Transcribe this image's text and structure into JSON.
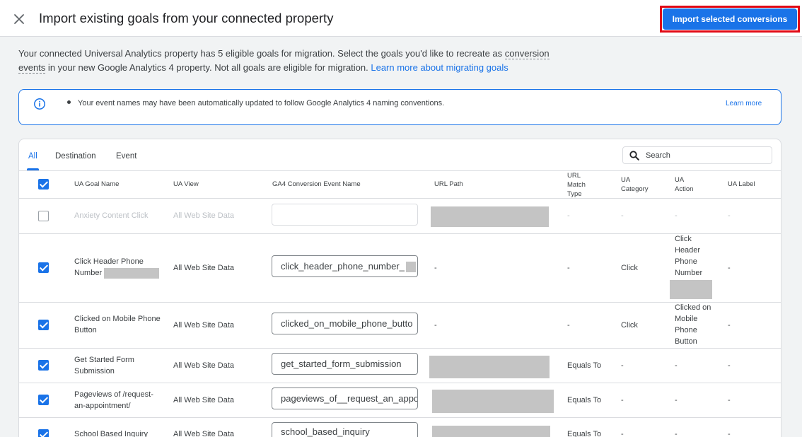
{
  "header": {
    "title": "Import existing goals from your connected property",
    "import_button": "Import selected conversions"
  },
  "description": {
    "part1": "Your connected Universal Analytics property has 5 eligible goals for migration. Select the goals you'd like to recreate as ",
    "conversion_word": "conversion",
    "events_word": "events",
    "part2": " in your new Google Analytics 4 property. Not all goals are eligible for migration. ",
    "learn_link": "Learn more about migrating goals"
  },
  "info": {
    "text": "Your event names may have been automatically updated to follow Google Analytics 4 naming conventions.",
    "learn_more": "Learn more"
  },
  "tabs": [
    "All",
    "Destination",
    "Event"
  ],
  "search": {
    "placeholder": "Search"
  },
  "columns": {
    "goal_name": "UA Goal Name",
    "view": "UA View",
    "event_name": "GA4 Conversion Event Name",
    "url_path": "URL Path",
    "match_type": "URL Match Type",
    "category": "UA Category",
    "action": "UA Action",
    "label": "UA Label"
  },
  "rows": [
    {
      "checked": false,
      "disabled": true,
      "goal_name": "Anxiety Content Click",
      "view": "All Web Site Data",
      "event_name": "",
      "url_path": "",
      "match_type": "-",
      "category": "-",
      "action": "-",
      "label": "-"
    },
    {
      "checked": true,
      "goal_name": "Click Header Phone Number",
      "view": "All Web Site Data",
      "event_name": "click_header_phone_number_",
      "url_path": "-",
      "match_type": "-",
      "category": "Click",
      "action": "Click Header Phone Number",
      "label": "-"
    },
    {
      "checked": true,
      "goal_name": "Clicked on Mobile Phone Button",
      "view": "All Web Site Data",
      "event_name": "clicked_on_mobile_phone_butto",
      "url_path": "-",
      "match_type": "-",
      "category": "Click",
      "action": "Clicked on Mobile Phone Button",
      "label": "-"
    },
    {
      "checked": true,
      "goal_name": "Get Started Form Submission",
      "view": "All Web Site Data",
      "event_name": "get_started_form_submission",
      "url_path": "",
      "match_type": "Equals To",
      "category": "-",
      "action": "-",
      "label": "-"
    },
    {
      "checked": true,
      "goal_name": "Pageviews of /request-an-appointment/",
      "view": "All Web Site Data",
      "event_name": "pageviews_of__request_an_appo",
      "url_path": "",
      "match_type": "Equals To",
      "category": "-",
      "action": "-",
      "label": "-"
    },
    {
      "checked": true,
      "goal_name": "School Based Inquiry",
      "view": "All Web Site Data",
      "event_name": "school_based_inquiry",
      "url_path": "",
      "match_type": "Equals To",
      "category": "-",
      "action": "-",
      "label": "-"
    }
  ],
  "colors": {
    "accent": "#1a73e8",
    "highlight": "#e10915"
  }
}
